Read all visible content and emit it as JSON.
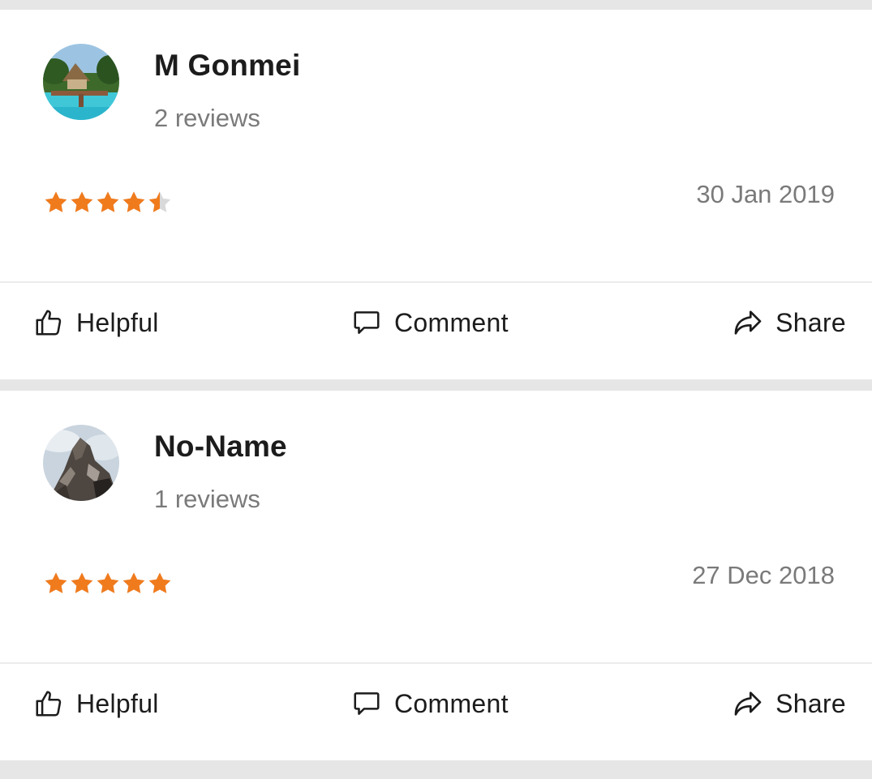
{
  "colors": {
    "star_filled": "#f07b1d",
    "star_empty": "#d9d9d9",
    "name_text": "#1c1c1c",
    "meta_text": "#7a7a7a",
    "page_background": "#e6e6e6",
    "card_background": "#ffffff"
  },
  "reviews": [
    {
      "author": "M Gonmei",
      "review_count": "2 reviews",
      "rating": 4.5,
      "rating_max": 5,
      "date": "30 Jan 2019",
      "avatar": "beach-resort-photo",
      "actions": {
        "helpful": "Helpful",
        "comment": "Comment",
        "share": "Share"
      }
    },
    {
      "author": "No-Name",
      "review_count": "1 reviews",
      "rating": 5,
      "rating_max": 5,
      "date": "27 Dec 2018",
      "avatar": "mountain-peak-photo",
      "actions": {
        "helpful": "Helpful",
        "comment": "Comment",
        "share": "Share"
      }
    }
  ],
  "icons": {
    "helpful": "thumbs-up-icon",
    "comment": "speech-bubble-icon",
    "share": "share-arrow-icon",
    "star": "star-icon"
  }
}
